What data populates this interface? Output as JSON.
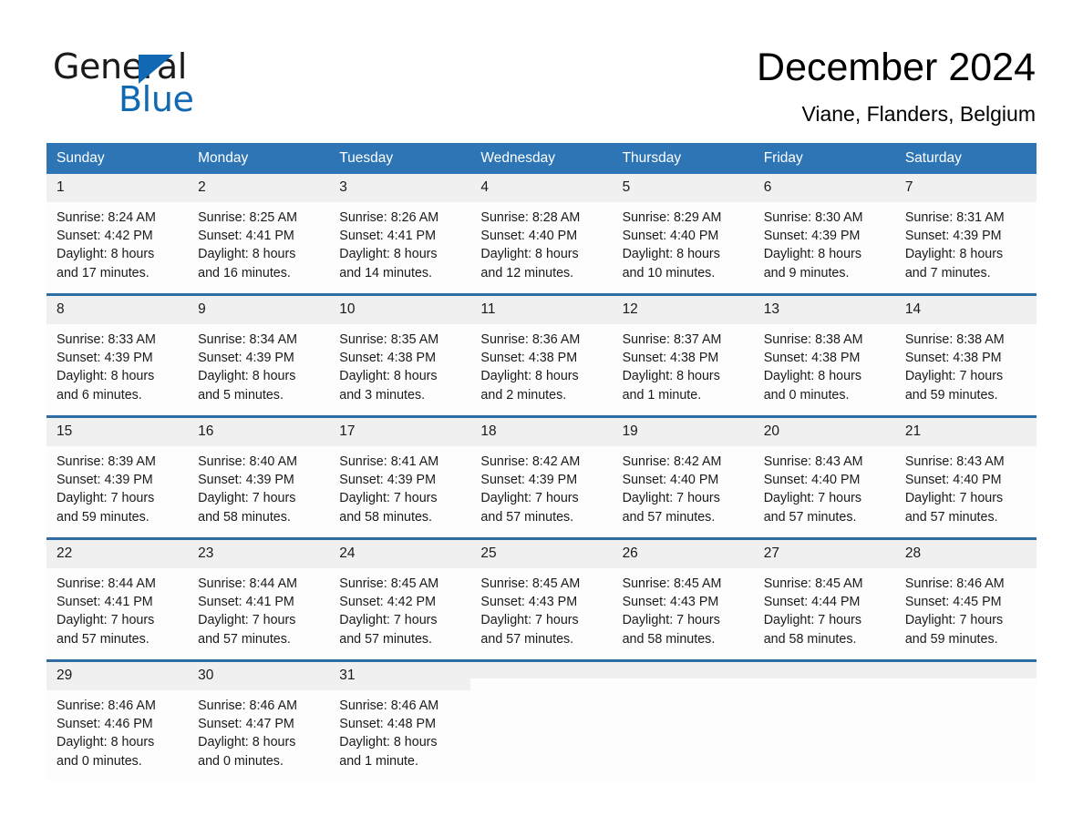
{
  "brand": {
    "logo_line1": "General",
    "logo_line2": "Blue",
    "accent_color": "#1168b3"
  },
  "header": {
    "title": "December 2024",
    "subtitle": "Viane, Flanders, Belgium"
  },
  "theme": {
    "header_blue": "#2e75b6",
    "row_rule_blue": "#2e6da4",
    "daynum_band": "#f0f0f0"
  },
  "labels": {
    "sunrise_prefix": "Sunrise:",
    "sunset_prefix": "Sunset:",
    "daylight_prefix": "Daylight:"
  },
  "weekday_headers": [
    "Sunday",
    "Monday",
    "Tuesday",
    "Wednesday",
    "Thursday",
    "Friday",
    "Saturday"
  ],
  "weeks": [
    [
      {
        "day": "1",
        "sunrise": "Sunrise: 8:24 AM",
        "sunset": "Sunset: 4:42 PM",
        "daylight": "Daylight: 8 hours and 17 minutes."
      },
      {
        "day": "2",
        "sunrise": "Sunrise: 8:25 AM",
        "sunset": "Sunset: 4:41 PM",
        "daylight": "Daylight: 8 hours and 16 minutes."
      },
      {
        "day": "3",
        "sunrise": "Sunrise: 8:26 AM",
        "sunset": "Sunset: 4:41 PM",
        "daylight": "Daylight: 8 hours and 14 minutes."
      },
      {
        "day": "4",
        "sunrise": "Sunrise: 8:28 AM",
        "sunset": "Sunset: 4:40 PM",
        "daylight": "Daylight: 8 hours and 12 minutes."
      },
      {
        "day": "5",
        "sunrise": "Sunrise: 8:29 AM",
        "sunset": "Sunset: 4:40 PM",
        "daylight": "Daylight: 8 hours and 10 minutes."
      },
      {
        "day": "6",
        "sunrise": "Sunrise: 8:30 AM",
        "sunset": "Sunset: 4:39 PM",
        "daylight": "Daylight: 8 hours and 9 minutes."
      },
      {
        "day": "7",
        "sunrise": "Sunrise: 8:31 AM",
        "sunset": "Sunset: 4:39 PM",
        "daylight": "Daylight: 8 hours and 7 minutes."
      }
    ],
    [
      {
        "day": "8",
        "sunrise": "Sunrise: 8:33 AM",
        "sunset": "Sunset: 4:39 PM",
        "daylight": "Daylight: 8 hours and 6 minutes."
      },
      {
        "day": "9",
        "sunrise": "Sunrise: 8:34 AM",
        "sunset": "Sunset: 4:39 PM",
        "daylight": "Daylight: 8 hours and 5 minutes."
      },
      {
        "day": "10",
        "sunrise": "Sunrise: 8:35 AM",
        "sunset": "Sunset: 4:38 PM",
        "daylight": "Daylight: 8 hours and 3 minutes."
      },
      {
        "day": "11",
        "sunrise": "Sunrise: 8:36 AM",
        "sunset": "Sunset: 4:38 PM",
        "daylight": "Daylight: 8 hours and 2 minutes."
      },
      {
        "day": "12",
        "sunrise": "Sunrise: 8:37 AM",
        "sunset": "Sunset: 4:38 PM",
        "daylight": "Daylight: 8 hours and 1 minute."
      },
      {
        "day": "13",
        "sunrise": "Sunrise: 8:38 AM",
        "sunset": "Sunset: 4:38 PM",
        "daylight": "Daylight: 8 hours and 0 minutes."
      },
      {
        "day": "14",
        "sunrise": "Sunrise: 8:38 AM",
        "sunset": "Sunset: 4:38 PM",
        "daylight": "Daylight: 7 hours and 59 minutes."
      }
    ],
    [
      {
        "day": "15",
        "sunrise": "Sunrise: 8:39 AM",
        "sunset": "Sunset: 4:39 PM",
        "daylight": "Daylight: 7 hours and 59 minutes."
      },
      {
        "day": "16",
        "sunrise": "Sunrise: 8:40 AM",
        "sunset": "Sunset: 4:39 PM",
        "daylight": "Daylight: 7 hours and 58 minutes."
      },
      {
        "day": "17",
        "sunrise": "Sunrise: 8:41 AM",
        "sunset": "Sunset: 4:39 PM",
        "daylight": "Daylight: 7 hours and 58 minutes."
      },
      {
        "day": "18",
        "sunrise": "Sunrise: 8:42 AM",
        "sunset": "Sunset: 4:39 PM",
        "daylight": "Daylight: 7 hours and 57 minutes."
      },
      {
        "day": "19",
        "sunrise": "Sunrise: 8:42 AM",
        "sunset": "Sunset: 4:40 PM",
        "daylight": "Daylight: 7 hours and 57 minutes."
      },
      {
        "day": "20",
        "sunrise": "Sunrise: 8:43 AM",
        "sunset": "Sunset: 4:40 PM",
        "daylight": "Daylight: 7 hours and 57 minutes."
      },
      {
        "day": "21",
        "sunrise": "Sunrise: 8:43 AM",
        "sunset": "Sunset: 4:40 PM",
        "daylight": "Daylight: 7 hours and 57 minutes."
      }
    ],
    [
      {
        "day": "22",
        "sunrise": "Sunrise: 8:44 AM",
        "sunset": "Sunset: 4:41 PM",
        "daylight": "Daylight: 7 hours and 57 minutes."
      },
      {
        "day": "23",
        "sunrise": "Sunrise: 8:44 AM",
        "sunset": "Sunset: 4:41 PM",
        "daylight": "Daylight: 7 hours and 57 minutes."
      },
      {
        "day": "24",
        "sunrise": "Sunrise: 8:45 AM",
        "sunset": "Sunset: 4:42 PM",
        "daylight": "Daylight: 7 hours and 57 minutes."
      },
      {
        "day": "25",
        "sunrise": "Sunrise: 8:45 AM",
        "sunset": "Sunset: 4:43 PM",
        "daylight": "Daylight: 7 hours and 57 minutes."
      },
      {
        "day": "26",
        "sunrise": "Sunrise: 8:45 AM",
        "sunset": "Sunset: 4:43 PM",
        "daylight": "Daylight: 7 hours and 58 minutes."
      },
      {
        "day": "27",
        "sunrise": "Sunrise: 8:45 AM",
        "sunset": "Sunset: 4:44 PM",
        "daylight": "Daylight: 7 hours and 58 minutes."
      },
      {
        "day": "28",
        "sunrise": "Sunrise: 8:46 AM",
        "sunset": "Sunset: 4:45 PM",
        "daylight": "Daylight: 7 hours and 59 minutes."
      }
    ],
    [
      {
        "day": "29",
        "sunrise": "Sunrise: 8:46 AM",
        "sunset": "Sunset: 4:46 PM",
        "daylight": "Daylight: 8 hours and 0 minutes."
      },
      {
        "day": "30",
        "sunrise": "Sunrise: 8:46 AM",
        "sunset": "Sunset: 4:47 PM",
        "daylight": "Daylight: 8 hours and 0 minutes."
      },
      {
        "day": "31",
        "sunrise": "Sunrise: 8:46 AM",
        "sunset": "Sunset: 4:48 PM",
        "daylight": "Daylight: 8 hours and 1 minute."
      },
      {
        "day": "",
        "sunrise": "",
        "sunset": "",
        "daylight": ""
      },
      {
        "day": "",
        "sunrise": "",
        "sunset": "",
        "daylight": ""
      },
      {
        "day": "",
        "sunrise": "",
        "sunset": "",
        "daylight": ""
      },
      {
        "day": "",
        "sunrise": "",
        "sunset": "",
        "daylight": ""
      }
    ]
  ]
}
